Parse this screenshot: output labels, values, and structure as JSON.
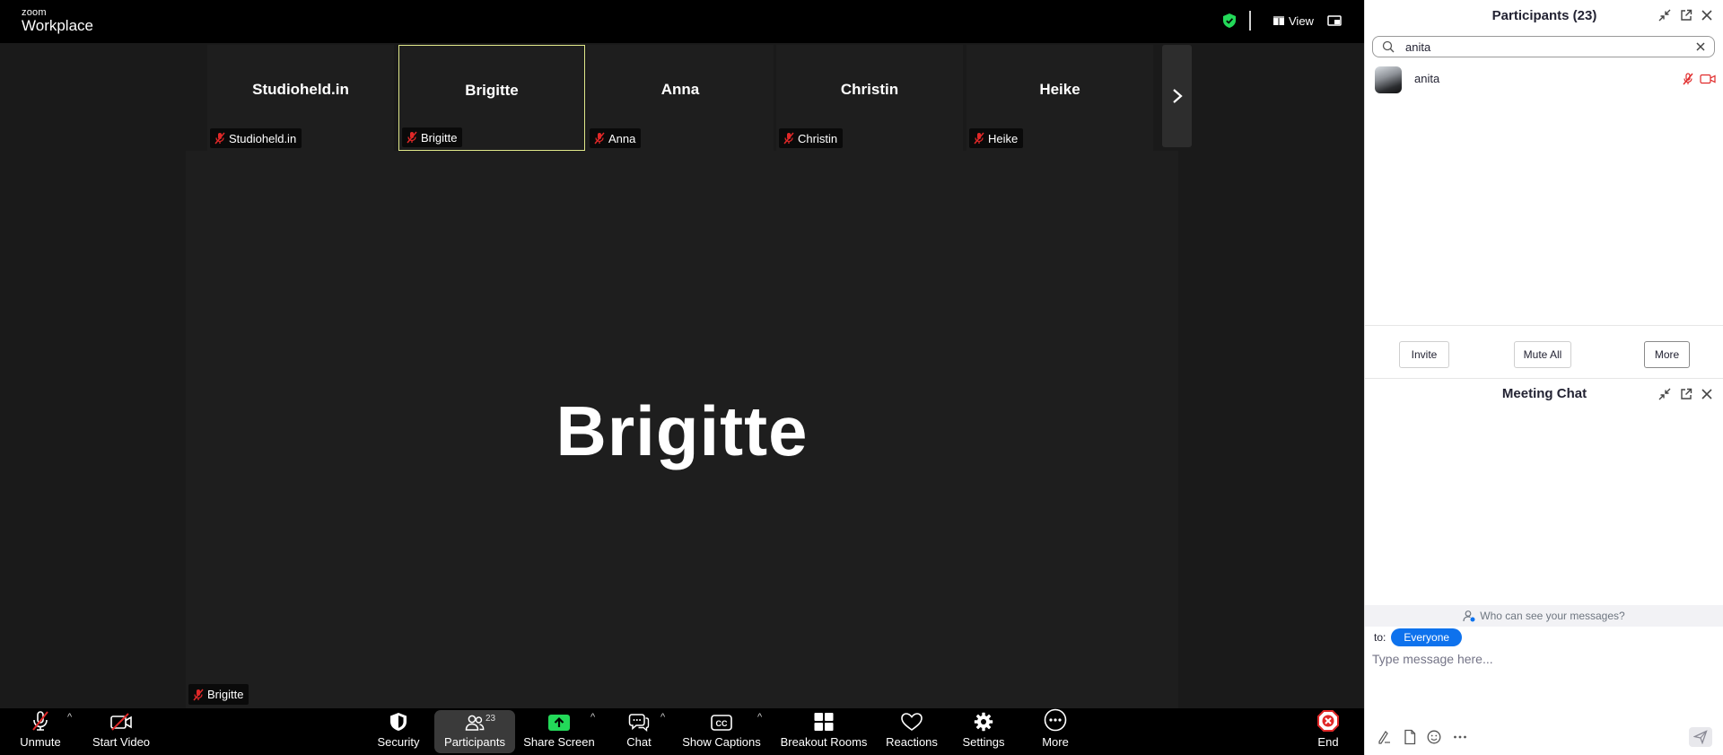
{
  "topbar": {
    "brand_line1": "zoom",
    "brand_line2": "Workplace",
    "view_label": "View"
  },
  "gallery": {
    "tiles": [
      {
        "name": "Studioheld.in",
        "label": "Studioheld.in"
      },
      {
        "name": "Brigitte",
        "label": "Brigitte"
      },
      {
        "name": "Anna",
        "label": "Anna"
      },
      {
        "name": "Christin",
        "label": "Christin"
      },
      {
        "name": "Heike",
        "label": "Heike"
      }
    ],
    "active_speaker": "Brigitte"
  },
  "stage": {
    "speaker_name": "Brigitte",
    "speaker_label": "Brigitte"
  },
  "toolbar": {
    "unmute": "Unmute",
    "start_video": "Start Video",
    "security": "Security",
    "participants": "Participants",
    "participants_count": "23",
    "share_screen": "Share Screen",
    "chat": "Chat",
    "show_captions": "Show Captions",
    "breakout_rooms": "Breakout Rooms",
    "reactions": "Reactions",
    "settings": "Settings",
    "more": "More",
    "end": "End"
  },
  "participants_panel": {
    "title": "Participants (23)",
    "search_value": "anita",
    "results": [
      {
        "name": "anita",
        "muted": true,
        "video_off": true
      }
    ],
    "invite": "Invite",
    "mute_all": "Mute All",
    "more": "More"
  },
  "chat_panel": {
    "title": "Meeting Chat",
    "who_can_see": "Who can see your messages?",
    "to_label": "to:",
    "recipient": "Everyone",
    "placeholder": "Type message here..."
  },
  "colors": {
    "accent_blue": "#0e72ed",
    "muted_red": "#e02828",
    "active_tile_border": "#e0e88a",
    "secure_green": "#23d959",
    "share_green": "#23d959"
  }
}
